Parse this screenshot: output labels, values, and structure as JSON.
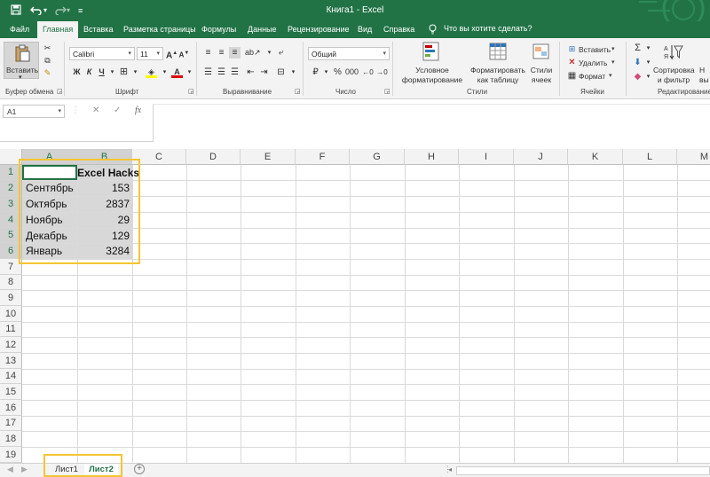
{
  "title_bar": {
    "doc_title": "Книга1  -  Excel",
    "save_icon": "save-icon",
    "undo_icon": "undo-icon",
    "redo_icon": "redo-icon"
  },
  "tabs": [
    "Файл",
    "Главная",
    "Вставка",
    "Разметка страницы",
    "Формулы",
    "Данные",
    "Рецензирование",
    "Вид",
    "Справка"
  ],
  "tell_me": "Что вы хотите сделать?",
  "ribbon": {
    "clipboard": {
      "paste": "Вставить",
      "label": "Буфер обмена"
    },
    "font": {
      "name": "Calibri",
      "size": "11",
      "label": "Шрифт",
      "bold": "Ж",
      "italic": "К",
      "underline": "Ч"
    },
    "alignment": {
      "label": "Выравнивание"
    },
    "number": {
      "format": "Общий",
      "label": "Число"
    },
    "styles": {
      "cond_line1": "Условное",
      "cond_line2": "форматирование",
      "table_line1": "Форматировать",
      "table_line2": "как таблицу",
      "cell_line1": "Стили",
      "cell_line2": "ячеек",
      "label": "Стили"
    },
    "cells": {
      "insert": "Вставить",
      "delete": "Удалить",
      "format": "Формат",
      "label": "Ячейки"
    },
    "editing": {
      "sort_line1": "Сортировка",
      "sort_line2": "и фильтр",
      "find_line1": "Н",
      "find_line2": "вы",
      "label": "Редактирование"
    }
  },
  "formula_bar": {
    "name_box": "A1",
    "fx": "fx",
    "cancel": "✕",
    "enter": "✓"
  },
  "columns": [
    "A",
    "B",
    "C",
    "D",
    "E",
    "F",
    "G",
    "H",
    "I",
    "J",
    "K",
    "L",
    "M"
  ],
  "rows": [
    "1",
    "2",
    "3",
    "4",
    "5",
    "6",
    "7",
    "8",
    "9",
    "10",
    "11",
    "12",
    "13",
    "14",
    "15",
    "16",
    "17",
    "18",
    "19"
  ],
  "cells": {
    "b1": "Excel Hacks",
    "a2": "Сентябрь",
    "b2": "153",
    "a3": "Октябрь",
    "b3": "2837",
    "a4": "Ноябрь",
    "b4": "29",
    "a5": "Декабрь",
    "b5": "129",
    "a6": "Январь",
    "b6": "3284"
  },
  "sheets": {
    "sheet1": "Лист1",
    "sheet2": "Лист2",
    "add": "+"
  },
  "colors": {
    "brand": "#217346",
    "highlight": "#f4c531",
    "selection": "#d8d8d8"
  }
}
